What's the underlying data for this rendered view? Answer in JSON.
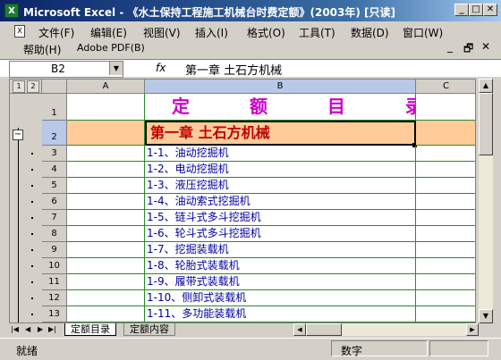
{
  "window": {
    "title": "Microsoft Excel - 《水土保持工程施工机械台时费定额》(2003年) [只读]",
    "app_icon": "X"
  },
  "menubar": {
    "items": [
      "文件(F)",
      "编辑(E)",
      "视图(V)",
      "插入(I)",
      "格式(O)",
      "工具(T)",
      "数据(D)",
      "窗口(W)"
    ],
    "row2": [
      "帮助(H)",
      "Adobe PDF(B)"
    ]
  },
  "formula_bar": {
    "name_box": "B2",
    "fx": "fx",
    "formula": "第一章 土石方机械"
  },
  "grid": {
    "columns": [
      "A",
      "B",
      "C"
    ],
    "outline_levels": [
      "1",
      "2"
    ],
    "rows": [
      {
        "num": "1",
        "b": "定 额 目 录",
        "style": "title"
      },
      {
        "num": "2",
        "b": "第一章 土石方机械",
        "style": "chapter"
      },
      {
        "num": "3",
        "b": "1-1、油动挖掘机"
      },
      {
        "num": "4",
        "b": "1-2、电动挖掘机"
      },
      {
        "num": "5",
        "b": "1-3、液压挖掘机"
      },
      {
        "num": "6",
        "b": "1-4、油动索式挖掘机"
      },
      {
        "num": "7",
        "b": "1-5、链斗式多斗挖掘机"
      },
      {
        "num": "8",
        "b": "1-6、轮斗式多斗挖掘机"
      },
      {
        "num": "9",
        "b": "1-7、挖掘装载机"
      },
      {
        "num": "10",
        "b": "1-8、轮胎式装载机"
      },
      {
        "num": "11",
        "b": "1-9、履带式装载机"
      },
      {
        "num": "12",
        "b": "1-10、侧卸式装载机"
      },
      {
        "num": "13",
        "b": "1-11、多功能装载机"
      }
    ]
  },
  "tabs": [
    "定额目录",
    "定额内容"
  ],
  "status": {
    "left": "就绪",
    "right": "数字"
  },
  "colors": {
    "title_text": "#cc00cc",
    "chapter_text": "#c00000",
    "chapter_fill": "#ffcc99",
    "gridline": "#2a8a2a"
  }
}
